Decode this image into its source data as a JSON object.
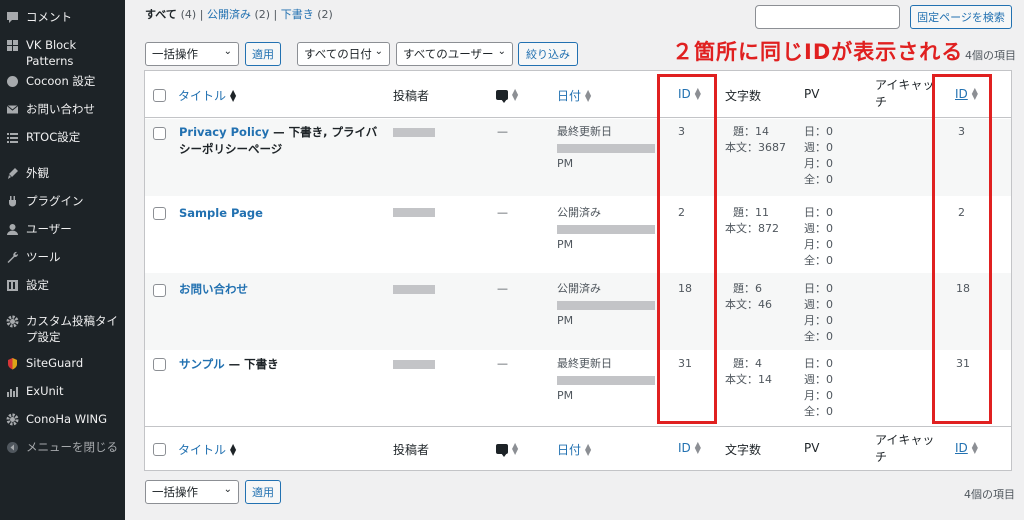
{
  "sidebar": {
    "items": [
      {
        "label": "コメント",
        "icon": "comment-icon"
      },
      {
        "label": "VK Block Patterns",
        "icon": "grid-icon"
      },
      {
        "label": "Cocoon 設定",
        "icon": "circle-icon"
      },
      {
        "label": "お問い合わせ",
        "icon": "mail-icon"
      },
      {
        "label": "RTOC設定",
        "icon": "list-icon"
      },
      {
        "label": "外観",
        "icon": "brush-icon"
      },
      {
        "label": "プラグイン",
        "icon": "plug-icon"
      },
      {
        "label": "ユーザー",
        "icon": "user-icon"
      },
      {
        "label": "ツール",
        "icon": "wrench-icon"
      },
      {
        "label": "設定",
        "icon": "settings-icon"
      },
      {
        "label": "カスタム投稿タイプ設定",
        "icon": "gear-icon"
      },
      {
        "label": "SiteGuard",
        "icon": "shield-icon"
      },
      {
        "label": "ExUnit",
        "icon": "chart-icon"
      },
      {
        "label": "ConoHa WING",
        "icon": "gear-icon"
      },
      {
        "label": "メニューを閉じる",
        "icon": "collapse-icon"
      }
    ]
  },
  "filters": {
    "all_label": "すべて",
    "all_count": "(4)",
    "published_label": "公開済み",
    "published_count": "(2)",
    "draft_label": "下書き",
    "draft_count": "(2)",
    "separator": "|"
  },
  "search": {
    "button_label": "固定ページを検索",
    "value": ""
  },
  "toolbar": {
    "bulk_action": "一括操作",
    "apply_label": "適用",
    "date_filter": "すべての日付",
    "user_filter": "すべてのユーザー",
    "filter_label": "絞り込み",
    "items_count": "4個の項目"
  },
  "annotation": "２箇所に同じIDが表示される",
  "columns": {
    "title": "タイトル",
    "author": "投稿者",
    "date": "日付",
    "id": "ID",
    "chars": "文字数",
    "pv": "PV",
    "eyecatch": "アイキャッチ",
    "id2": "ID"
  },
  "rows": [
    {
      "title": "Privacy Policy",
      "state": " — 下書き, プライバシーポリシーページ",
      "author_dash": "",
      "comment": "—",
      "date_status": "最終更新日",
      "date_time": "PM",
      "id": "3",
      "chars_title": "題：14",
      "chars_body": "本文：3687",
      "pv": [
        "日：0",
        "週：0",
        "月：0",
        "全：0"
      ],
      "id2": "3"
    },
    {
      "title": "Sample Page",
      "state": "",
      "comment": "—",
      "date_status": "公開済み",
      "date_time": "PM",
      "id": "2",
      "chars_title": "題：11",
      "chars_body": "本文：872",
      "pv": [
        "日：0",
        "週：0",
        "月：0",
        "全：0"
      ],
      "id2": "2"
    },
    {
      "title": "お問い合わせ",
      "state": "",
      "comment": "—",
      "date_status": "公開済み",
      "date_time": "PM",
      "id": "18",
      "chars_title": "題：6",
      "chars_body": "本文：46",
      "pv": [
        "日：0",
        "週：0",
        "月：0",
        "全：0"
      ],
      "id2": "18"
    },
    {
      "title": "サンプル",
      "state": " — 下書き",
      "comment": "—",
      "date_status": "最終更新日",
      "date_time": "PM",
      "id": "31",
      "chars_title": "題：4",
      "chars_body": "本文：14",
      "pv": [
        "日：0",
        "週：0",
        "月：0",
        "全：0"
      ],
      "id2": "31"
    }
  ],
  "colors": {
    "accent": "#2271b1",
    "annotation": "#e02020",
    "sidebar": "#1d2327"
  }
}
